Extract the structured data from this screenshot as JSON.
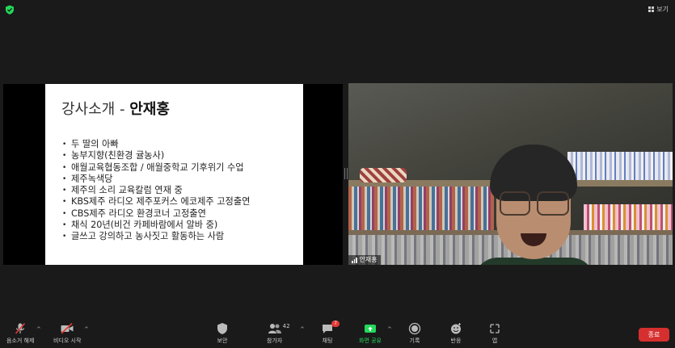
{
  "top": {
    "view_label": "보기",
    "security_icon": "green-shield-icon",
    "view_icon": "grid-icon"
  },
  "slide": {
    "title_prefix": "강사소개 -",
    "title_name": "안재홍",
    "bullets": [
      "두 딸의 아빠",
      "농부지향(친환경 귤농사)",
      "애월교육협동조합 / 애월중학교 기후위기 수업",
      "제주녹색당",
      "제주의 소리 교육칼럼 연재 중",
      "KBS제주 라디오 제주포커스 에코제주 고정출연",
      "CBS제주 라디오 환경코너 고정출연",
      "채식 20년(비건 카페바람에서 알바 중)",
      "글쓰고 강의하고 농사짓고 활동하는 사람"
    ]
  },
  "video": {
    "participant_name": "안재홍"
  },
  "toolbar": {
    "mute_label": "음소거 해제",
    "video_label": "비디오 시작",
    "security_label": "보안",
    "participants_label": "참가자",
    "participants_count": "42",
    "chat_label": "채팅",
    "chat_badge": "7",
    "share_label": "화면 공유",
    "record_label": "기록",
    "reactions_label": "반응",
    "apps_label": "앱",
    "end_label": "종료"
  },
  "colors": {
    "accent_green": "#23d959",
    "end_red": "#d62f2f",
    "badge_red": "#e53935"
  }
}
